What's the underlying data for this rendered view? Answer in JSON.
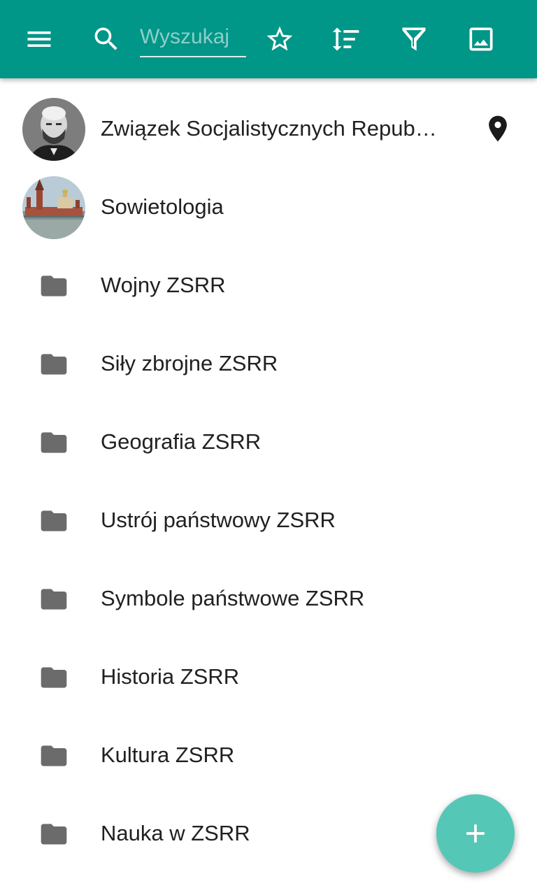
{
  "toolbar": {
    "background": "#009688",
    "search": {
      "placeholder": "Wyszukaj",
      "value": ""
    },
    "icons": [
      "menu-icon",
      "search-icon",
      "star-outline-icon",
      "sort-icon",
      "filter-icon",
      "image-icon"
    ]
  },
  "list": {
    "items": [
      {
        "label": "Związek Socjalistycznych Republik Radzieckich",
        "icon": "avatar-portrait",
        "has_location": true
      },
      {
        "label": "Sowietologia",
        "icon": "avatar-kremlin"
      },
      {
        "label": "Wojny ZSRR",
        "icon": "folder-icon"
      },
      {
        "label": "Siły zbrojne ZSRR",
        "icon": "folder-icon"
      },
      {
        "label": "Geografia ZSRR",
        "icon": "folder-icon"
      },
      {
        "label": "Ustrój państwowy ZSRR",
        "icon": "folder-icon"
      },
      {
        "label": "Symbole państwowe ZSRR",
        "icon": "folder-icon"
      },
      {
        "label": "Historia ZSRR",
        "icon": "folder-icon"
      },
      {
        "label": "Kultura ZSRR",
        "icon": "folder-icon"
      },
      {
        "label": "Nauka w ZSRR",
        "icon": "folder-icon"
      }
    ]
  },
  "fab": {
    "icon": "plus-icon",
    "color": "#55c7b6"
  }
}
